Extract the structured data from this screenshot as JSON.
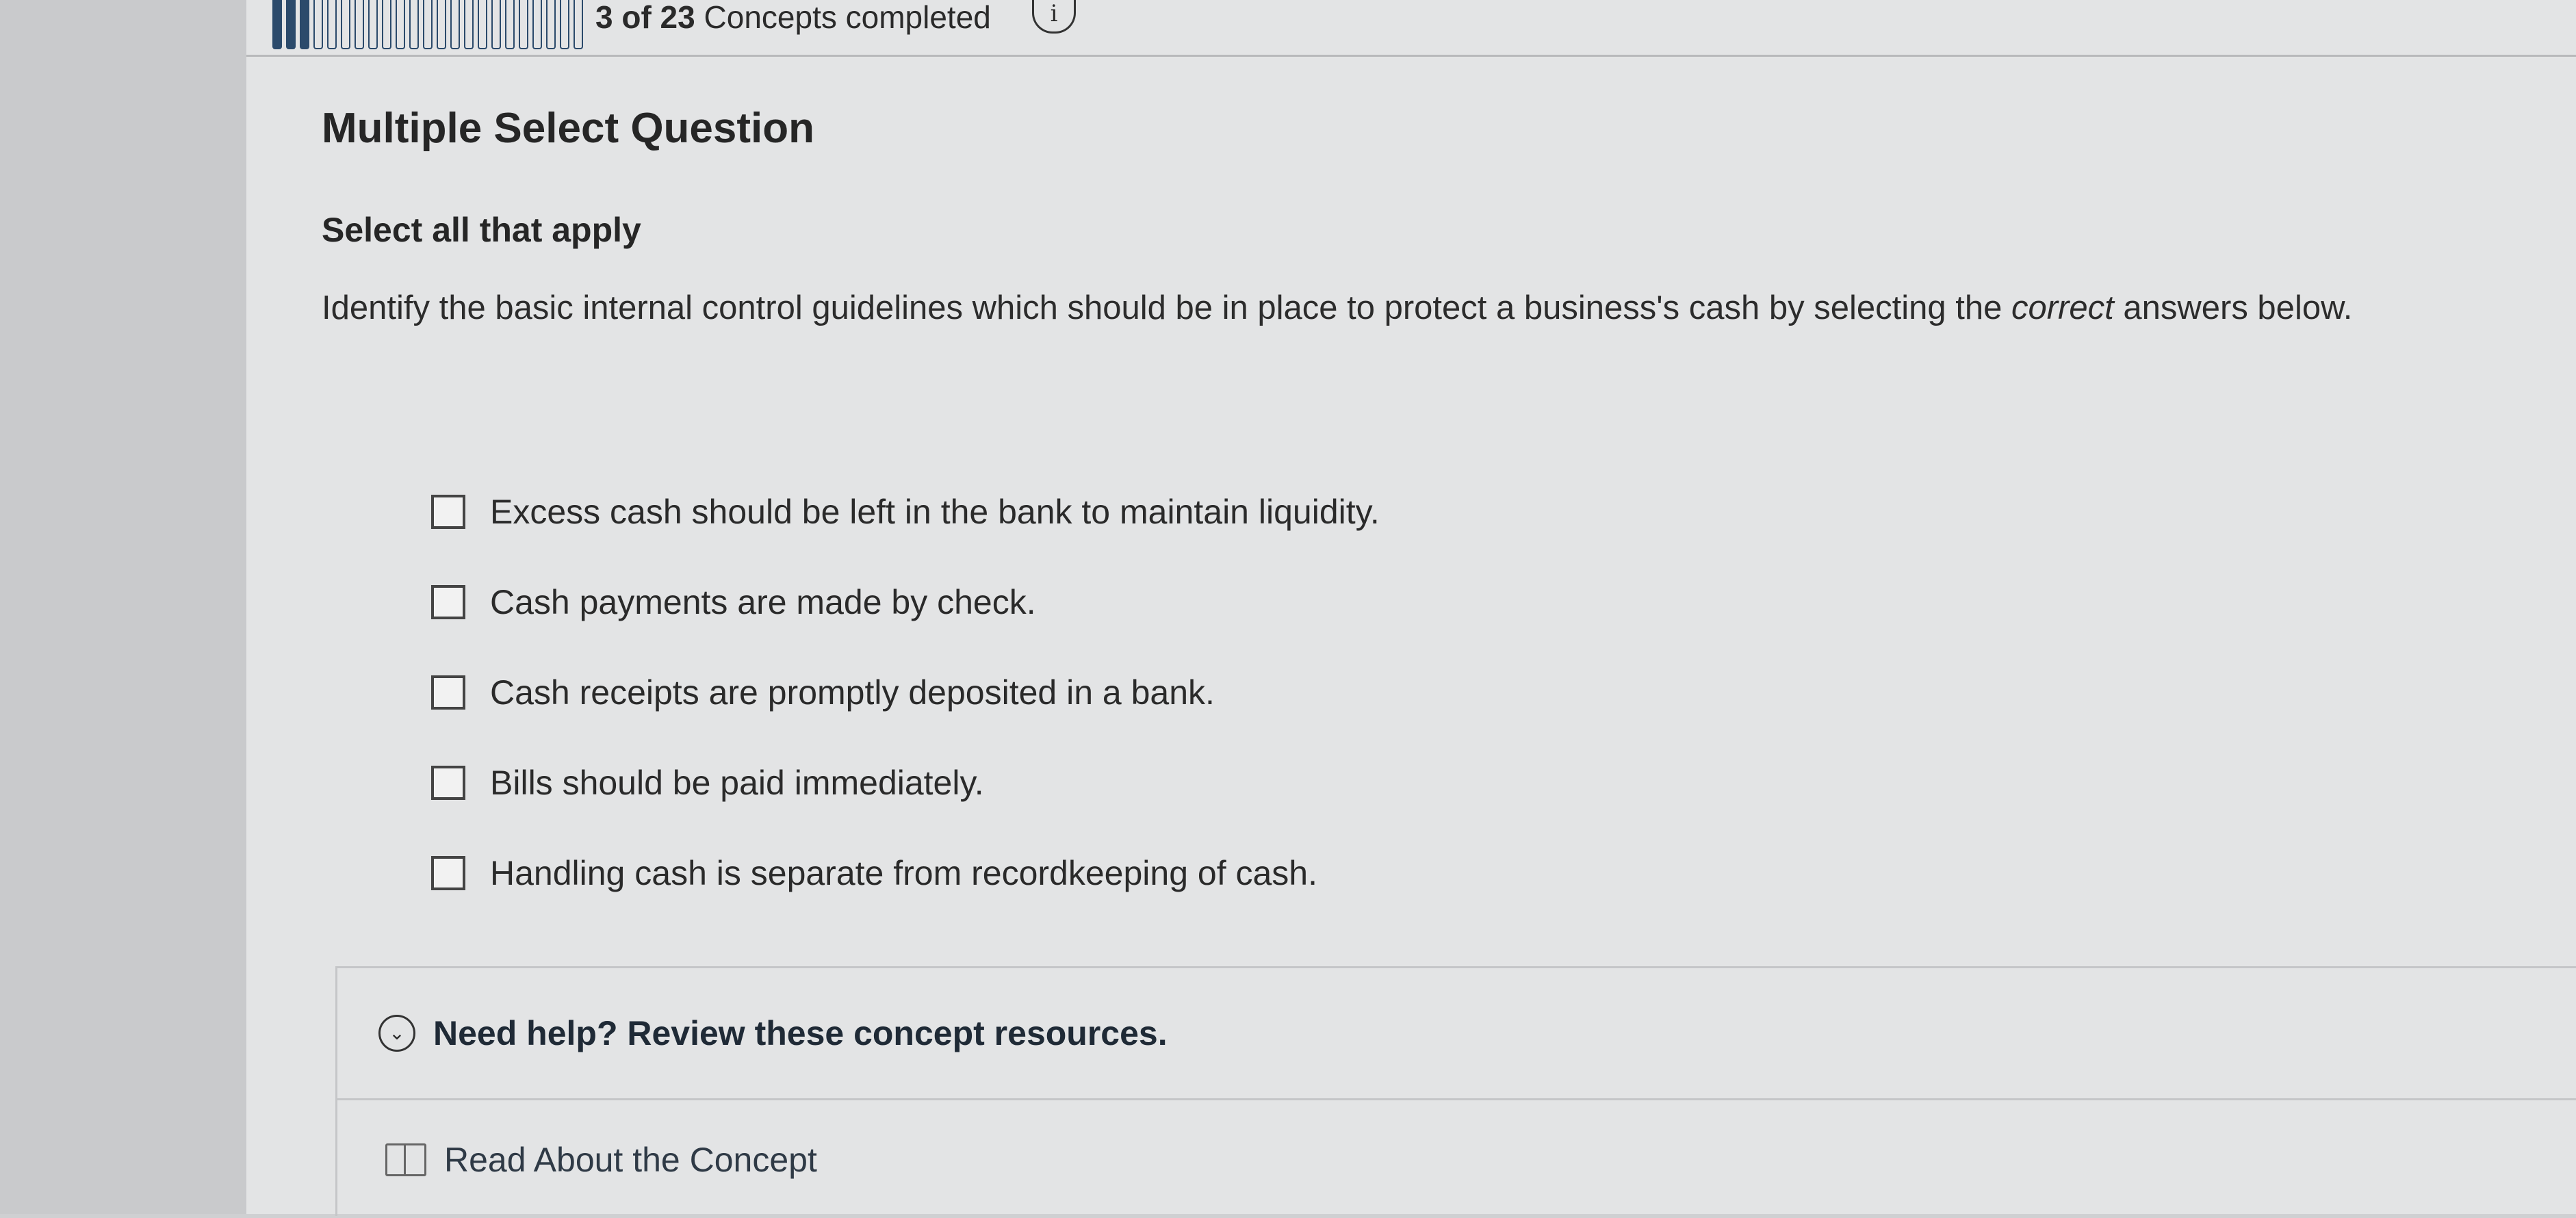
{
  "progress": {
    "count_text": "3 of 23",
    "label_text": "Concepts completed",
    "completed": 3,
    "total": 23,
    "info_icon": "i"
  },
  "question": {
    "type_title": "Multiple Select Question",
    "instruction": "Select all that apply",
    "prompt_before": "Identify the basic internal control guidelines which should be in place to protect a business's cash by selecting the ",
    "prompt_emphasis": "correct",
    "prompt_after": " answers below.",
    "options": [
      {
        "label": "Excess cash should be left in the bank to maintain liquidity.",
        "checked": false
      },
      {
        "label": "Cash payments are made by check.",
        "checked": false
      },
      {
        "label": "Cash receipts are promptly deposited in a bank.",
        "checked": false
      },
      {
        "label": "Bills should be paid immediately.",
        "checked": false
      },
      {
        "label": "Handling cash is separate from recordkeeping of cash.",
        "checked": false
      }
    ]
  },
  "help": {
    "toggle_label": "Need help? Review these concept resources.",
    "resource_label": "Read About the Concept"
  },
  "colors": {
    "progress_fill": "#2b4a6b",
    "page_background": "#e3e4e5"
  },
  "icons": {
    "info": "info-icon",
    "toggle": "chevron-down-circle-icon",
    "resource": "book-icon"
  }
}
